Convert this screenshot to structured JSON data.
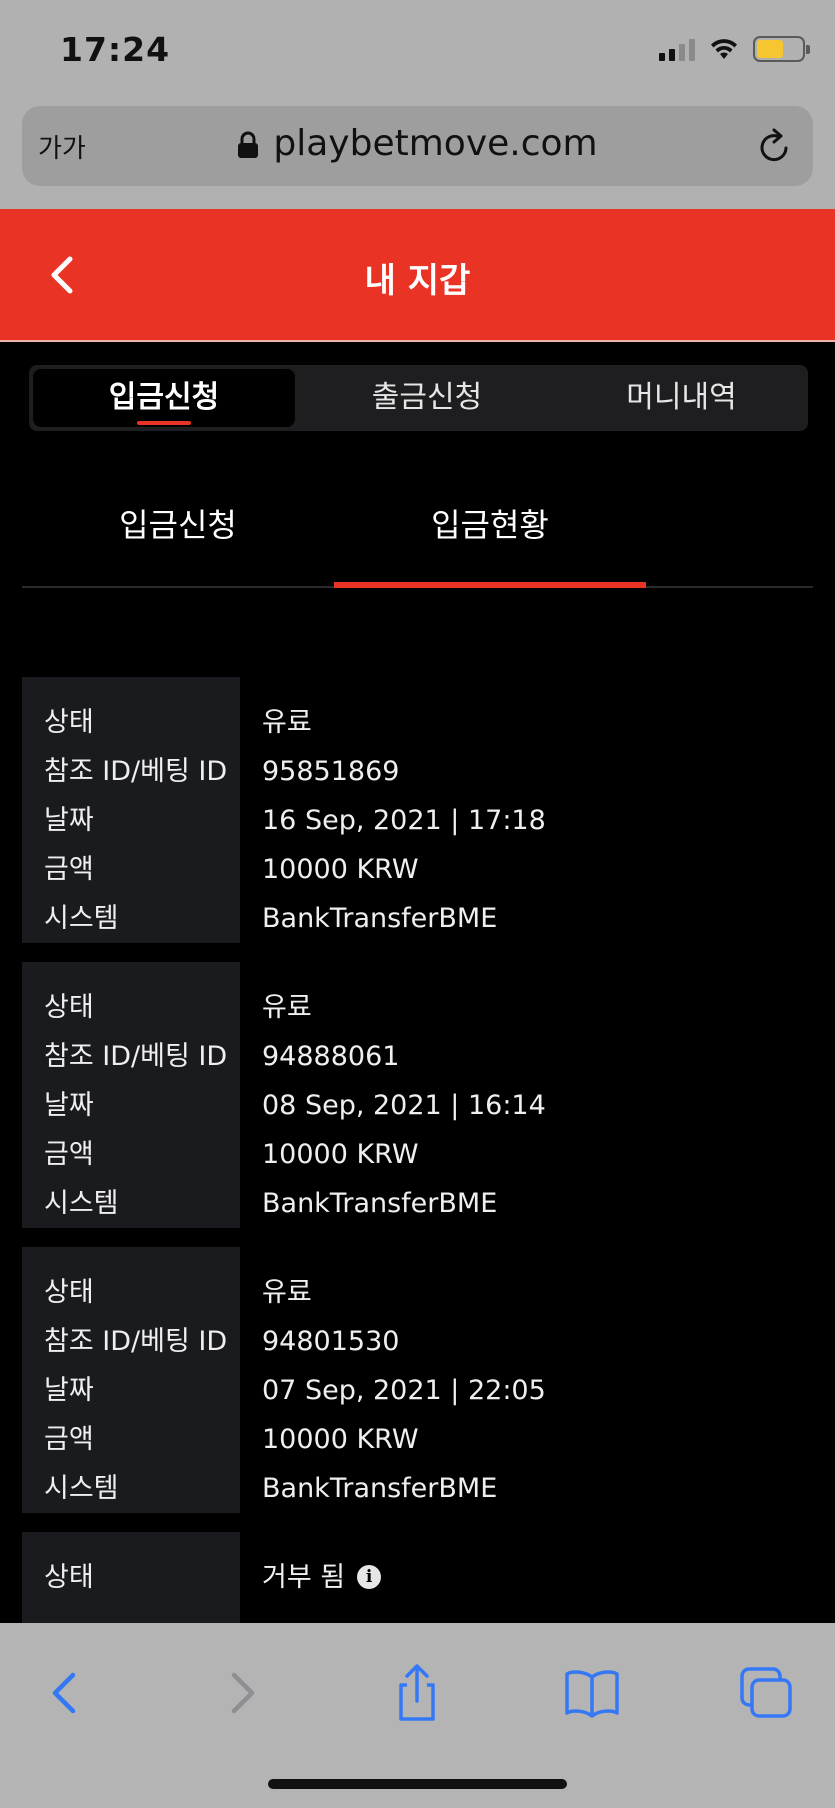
{
  "status_bar": {
    "time": "17:24"
  },
  "browser": {
    "text_size_label": "가가",
    "url": "playbetmove.com"
  },
  "header": {
    "title": "내 지갑"
  },
  "segments": [
    "입금신청",
    "출금신청",
    "머니내역"
  ],
  "subtabs": [
    "입금신청",
    "입금현황"
  ],
  "labels": {
    "status": "상태",
    "ref_id": "참조 ID/베팅 ID",
    "date": "날짜",
    "amount": "금액",
    "system": "시스템"
  },
  "records": [
    {
      "status": "유료",
      "ref_id": "95851869",
      "date": "16 Sep, 2021 | 17:18",
      "amount": "10000 KRW",
      "system": "BankTransferBME"
    },
    {
      "status": "유료",
      "ref_id": "94888061",
      "date": "08 Sep, 2021 | 16:14",
      "amount": "10000 KRW",
      "system": "BankTransferBME"
    },
    {
      "status": "유료",
      "ref_id": "94801530",
      "date": "07 Sep, 2021 | 22:05",
      "amount": "10000 KRW",
      "system": "BankTransferBME"
    },
    {
      "status": "거부 됨"
    }
  ],
  "colors": {
    "accent": "#e83325",
    "ios_blue": "#3478f6"
  }
}
